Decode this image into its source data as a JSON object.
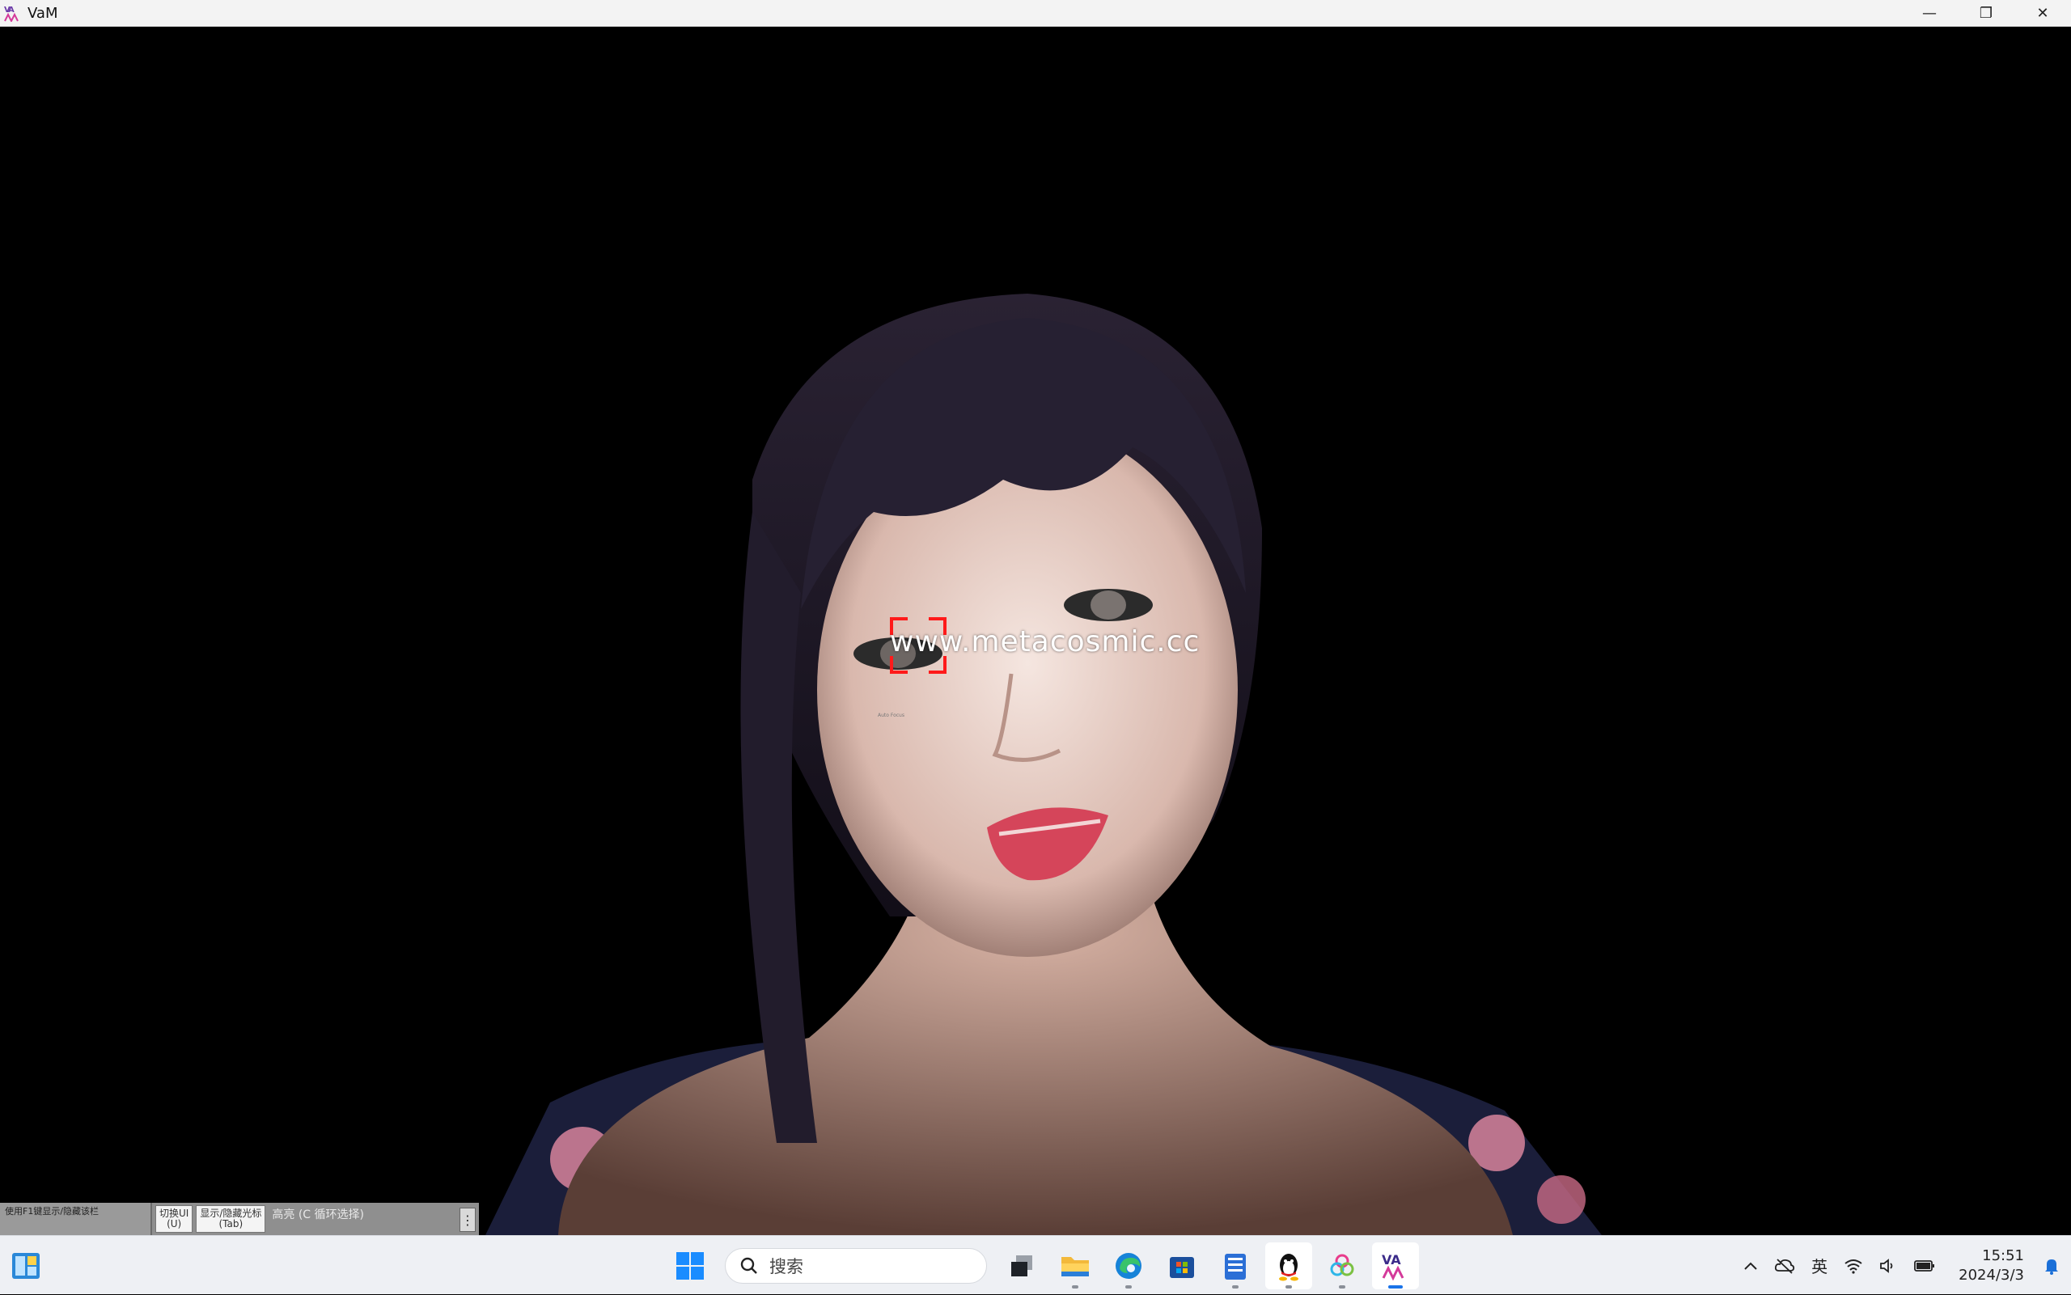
{
  "window": {
    "title": "VaM",
    "logo_text": "VAM",
    "controls": {
      "minimize": "—",
      "restore": "❐",
      "close": "✕"
    }
  },
  "viewport": {
    "watermark": "www.metacosmic.cc",
    "focus_caption": "Auto Focus"
  },
  "vam_toolbar": {
    "hint_text": "使用F1键显示/隐藏该栏",
    "toggle_ui_label": "切换UI",
    "toggle_ui_key": "(U)",
    "cursor_label": "显示/隐藏光标",
    "cursor_key": "(Tab)",
    "highlight_label": "高亮 (C 循环选择)",
    "menu_glyph": "⋮"
  },
  "taskbar": {
    "search_placeholder": "搜索",
    "ime_label": "英",
    "time": "15:51",
    "date": "2024/3/3",
    "pinned_apps": [
      {
        "name": "start-icon"
      },
      {
        "name": "task-view-icon"
      },
      {
        "name": "file-explorer-icon"
      },
      {
        "name": "edge-icon"
      },
      {
        "name": "microsoft-store-icon"
      },
      {
        "name": "notepad-icon"
      },
      {
        "name": "qq-icon"
      },
      {
        "name": "app-cluster-icon"
      },
      {
        "name": "vam-icon"
      }
    ],
    "accent": "#1a73e8"
  }
}
